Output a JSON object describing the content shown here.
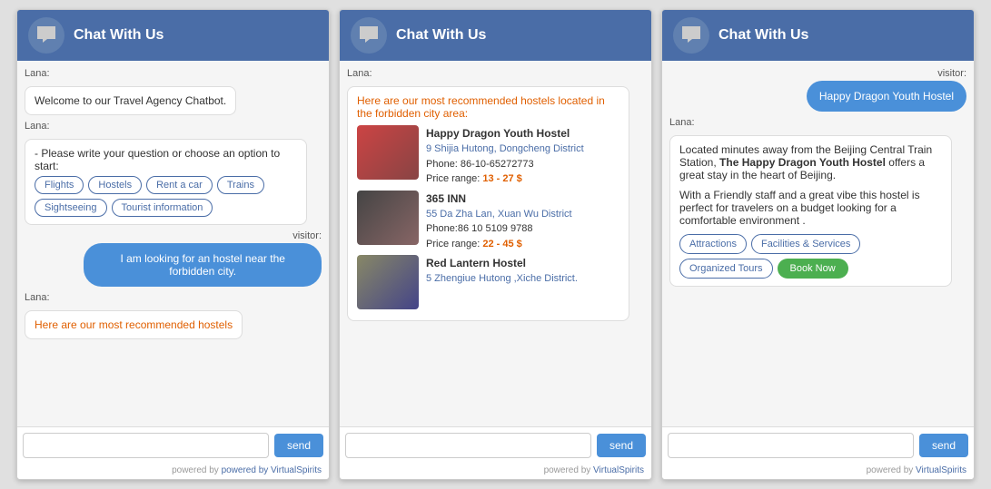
{
  "widgets": [
    {
      "id": "widget1",
      "header": {
        "title": "Chat With Us"
      },
      "messages": [
        {
          "type": "lana",
          "sender": "Lana:",
          "text": "Welcome to our Travel Agency Chatbot."
        },
        {
          "type": "lana-options",
          "sender": "Lana:",
          "intro": " - Please write your question or choose an option to start:",
          "options": [
            "Flights",
            "Hostels",
            "Rent a car",
            "Trains",
            "Sightseeing",
            "Tourist information"
          ]
        },
        {
          "type": "visitor",
          "sender": "visitor:",
          "text": "I am looking for an hostel near the forbidden city."
        },
        {
          "type": "lana",
          "sender": "Lana:",
          "text": "Here are our most recommended hostels"
        }
      ],
      "input_placeholder": "",
      "send_label": "send",
      "footer": "powered by VirtualSpirits"
    },
    {
      "id": "widget2",
      "header": {
        "title": "Chat With Us"
      },
      "messages": [
        {
          "type": "lana-hostels",
          "sender": "Lana:",
          "intro": "Here are our most recommended hostels located in the forbidden city area:",
          "hostels": [
            {
              "name": "Happy Dragon Youth Hostel",
              "address": "9 Shijia Hutong, Dongcheng District",
              "phone": "Phone: 86-10-65272773",
              "price_prefix": "Price range: ",
              "price": "13 - 27 $",
              "img_class": "hostel-img-1"
            },
            {
              "name": "365 INN",
              "address": "55 Da Zha Lan, Xuan Wu District",
              "phone": "Phone:86 10 5109 9788",
              "price_prefix": "Price range: ",
              "price": "22 - 45 $",
              "img_class": "hostel-img-2"
            },
            {
              "name": "Red Lantern Hostel",
              "address": "5 Zhengiue Hutong ,Xiche District.",
              "phone": "",
              "price_prefix": "",
              "price": "",
              "img_class": "hostel-img-3"
            }
          ]
        }
      ],
      "input_placeholder": "",
      "send_label": "send",
      "footer": "powered by VirtualSpirits"
    },
    {
      "id": "widget3",
      "header": {
        "title": "Chat With Us"
      },
      "messages": [
        {
          "type": "visitor",
          "sender": "visitor:",
          "text": "Happy Dragon Youth Hostel"
        },
        {
          "type": "lana-detail",
          "sender": "Lana:",
          "text_parts": [
            {
              "text": "Located minutes away from the Beijing Central Train Station, ",
              "bold": false
            },
            {
              "text": "The Happy Dragon Youth Hostel",
              "bold": true
            },
            {
              "text": " offers a great stay in the heart of Beijing.",
              "bold": false
            }
          ],
          "text2": "With a Friendly staff and a great vibe this hostel is perfect for travelers on a budget looking for a comfortable environment .",
          "buttons": [
            {
              "label": "Attractions",
              "type": "outline"
            },
            {
              "label": "Facilities & Services",
              "type": "outline"
            },
            {
              "label": "Organized Tours",
              "type": "outline"
            },
            {
              "label": "Book Now",
              "type": "green"
            }
          ]
        }
      ],
      "input_placeholder": "",
      "send_label": "send",
      "footer": "powered by VirtualSpirits"
    }
  ]
}
